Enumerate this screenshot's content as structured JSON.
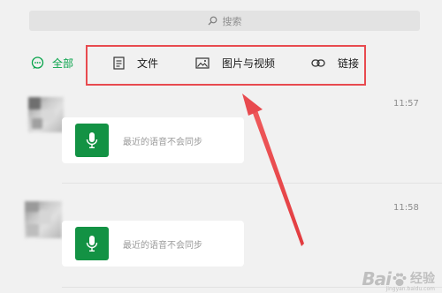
{
  "search": {
    "placeholder": "搜索"
  },
  "tabs": [
    {
      "label": "全部",
      "icon": "chat-bubble-icon",
      "active": true
    },
    {
      "label": "文件",
      "icon": "document-icon",
      "active": false
    },
    {
      "label": "图片与视频",
      "icon": "image-icon",
      "active": false
    },
    {
      "label": "链接",
      "icon": "link-icon",
      "active": false
    }
  ],
  "messages": [
    {
      "time": "11:57",
      "card_text": "最近的语音不会同步",
      "icon": "microphone-icon"
    },
    {
      "time": "11:58",
      "card_text": "最近的语音不会同步",
      "icon": "microphone-icon"
    }
  ],
  "watermark": {
    "brand": "Bai",
    "suffix": "经验",
    "site": "jingyan.baidu.com"
  },
  "colors": {
    "accent": "#07a34a",
    "mic_bg": "#139244",
    "annotation": "#e84a4f",
    "background": "#f1f1f1"
  }
}
